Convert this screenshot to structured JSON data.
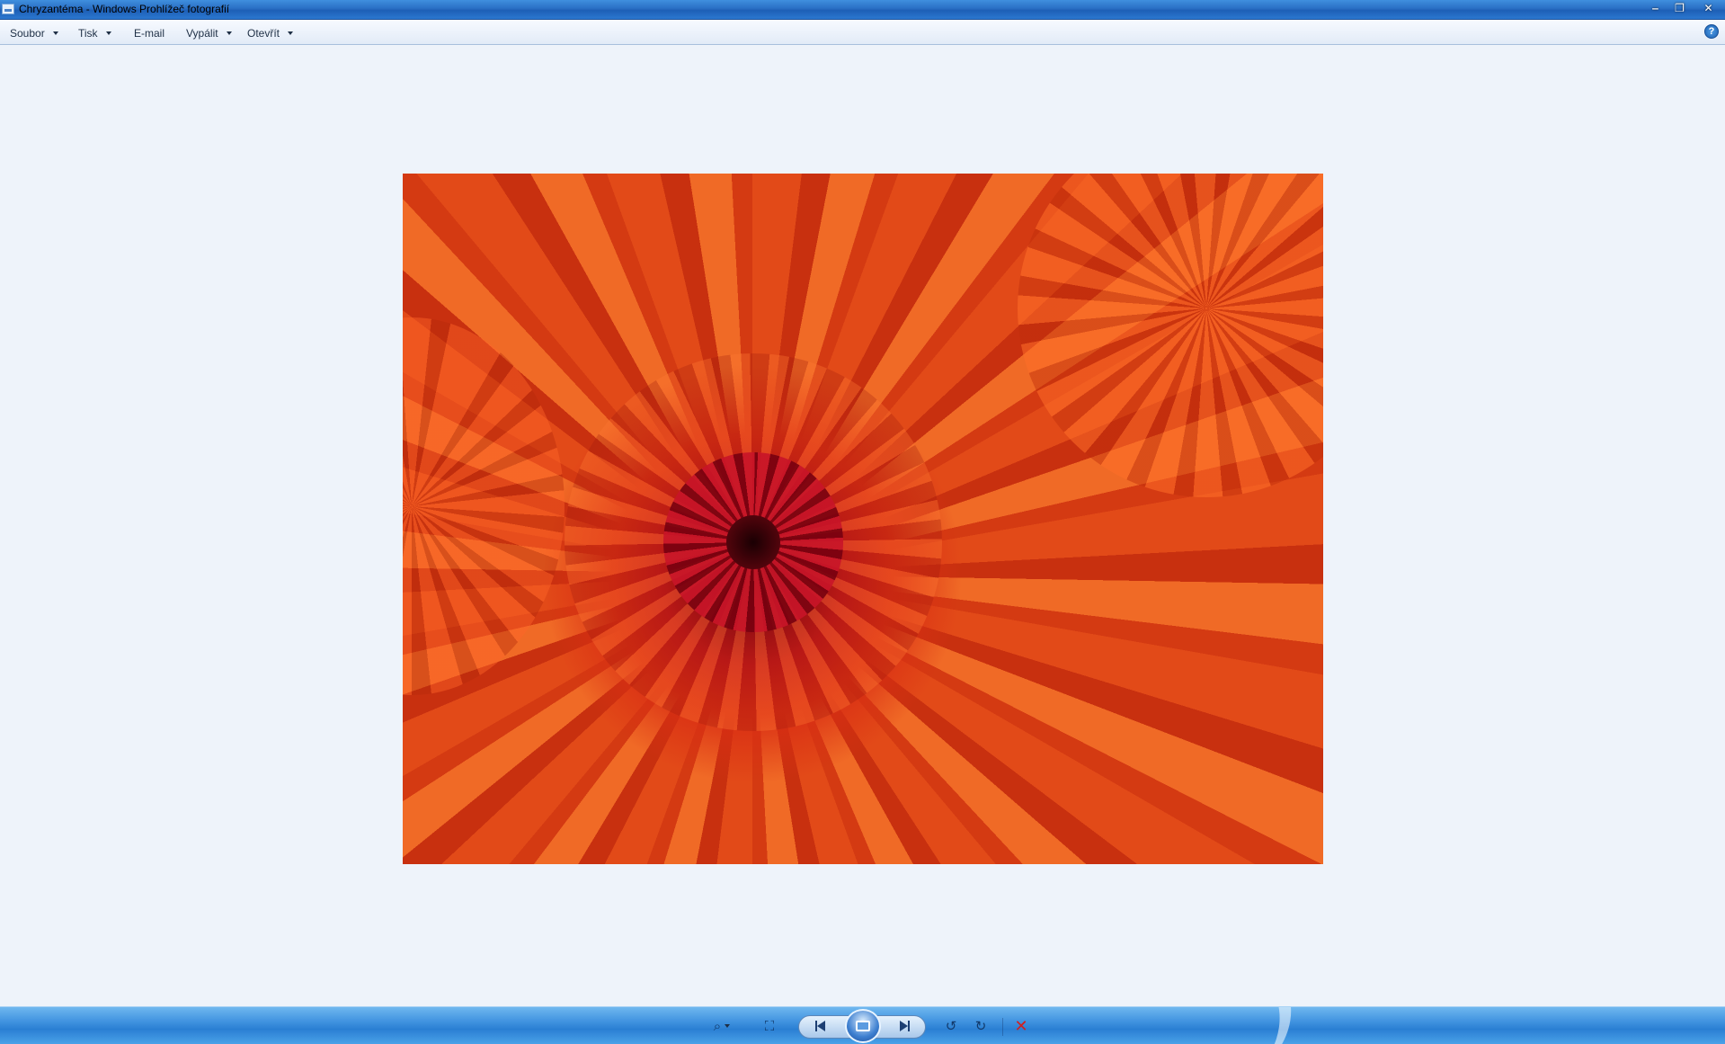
{
  "window": {
    "title": "Chryzantéma - Windows Prohlížeč fotografií",
    "controls": {
      "minimize": "‒",
      "restore": "❐",
      "close": "✕"
    }
  },
  "menu": {
    "items": [
      {
        "label": "Soubor",
        "has_dropdown": true
      },
      {
        "label": "Tisk",
        "has_dropdown": true
      },
      {
        "label": "E-mail",
        "has_dropdown": false
      },
      {
        "label": "Vypálit",
        "has_dropdown": true
      },
      {
        "label": "Otevřít",
        "has_dropdown": true
      }
    ],
    "help_glyph": "?"
  },
  "photo": {
    "description_name": "Chryzantéma",
    "dominant_color": "#e04a18"
  },
  "controls": {
    "zoom_glyph": "⌕",
    "fit_glyph": "⛶",
    "rotate_left_glyph": "↺",
    "rotate_right_glyph": "↻",
    "delete_glyph": "✕"
  },
  "colors": {
    "titlebar": "#2a6fc4",
    "viewer_background": "#eef3fa",
    "bottombar": "#3f92df",
    "delete": "#d21f1f"
  }
}
